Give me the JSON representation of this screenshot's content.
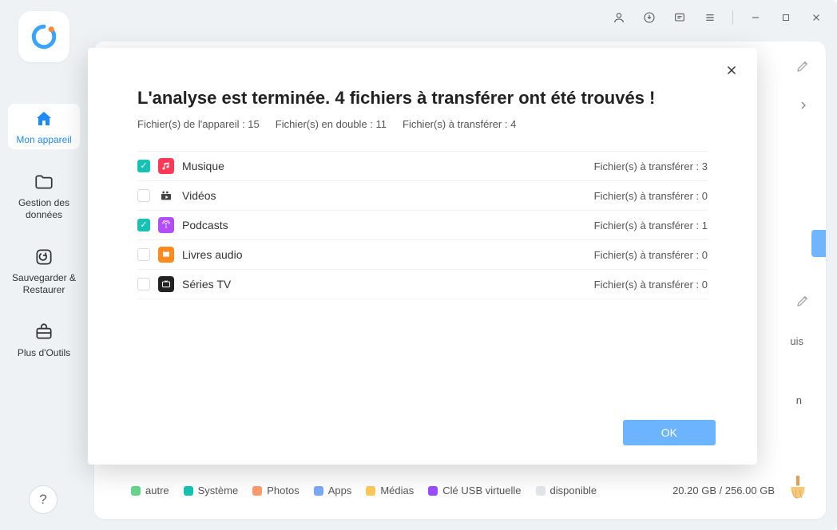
{
  "sidebar": {
    "items": [
      {
        "label": "Mon appareil"
      },
      {
        "label": "Gestion des données"
      },
      {
        "label": "Sauvegarder & Restaurer"
      },
      {
        "label": "Plus d'Outils"
      }
    ]
  },
  "modal": {
    "title": "L'analyse est terminée. 4 fichiers à transférer ont été trouvés !",
    "stats": {
      "device": "Fichier(s) de l'appareil : 15",
      "duplicate": "Fichier(s) en double : 11",
      "transfer": "Fichier(s) à transférer : 4"
    },
    "categories": [
      {
        "label": "Musique",
        "count_text": "Fichier(s) à transférer : 3",
        "checked": true
      },
      {
        "label": "Vidéos",
        "count_text": "Fichier(s) à transférer : 0",
        "checked": false
      },
      {
        "label": "Podcasts",
        "count_text": "Fichier(s) à transférer : 1",
        "checked": true
      },
      {
        "label": "Livres audio",
        "count_text": "Fichier(s) à transférer : 0",
        "checked": false
      },
      {
        "label": "Séries TV",
        "count_text": "Fichier(s) à transférer : 0",
        "checked": false
      }
    ],
    "ok_label": "OK"
  },
  "storage": {
    "legend": [
      {
        "label": "autre",
        "color": "#66d68b"
      },
      {
        "label": "Système",
        "color": "#17c2b5"
      },
      {
        "label": "Photos",
        "color": "#ff9a6b"
      },
      {
        "label": "Apps",
        "color": "#7aa9ff"
      },
      {
        "label": "Médias",
        "color": "#ffc95a"
      },
      {
        "label": "Clé USB virtuelle",
        "color": "#9a4dff"
      },
      {
        "label": "disponible",
        "color": "#e3e6ea"
      }
    ],
    "text": "20.20 GB / 256.00 GB"
  },
  "bg": {
    "uis": "uis",
    "n": "n"
  }
}
